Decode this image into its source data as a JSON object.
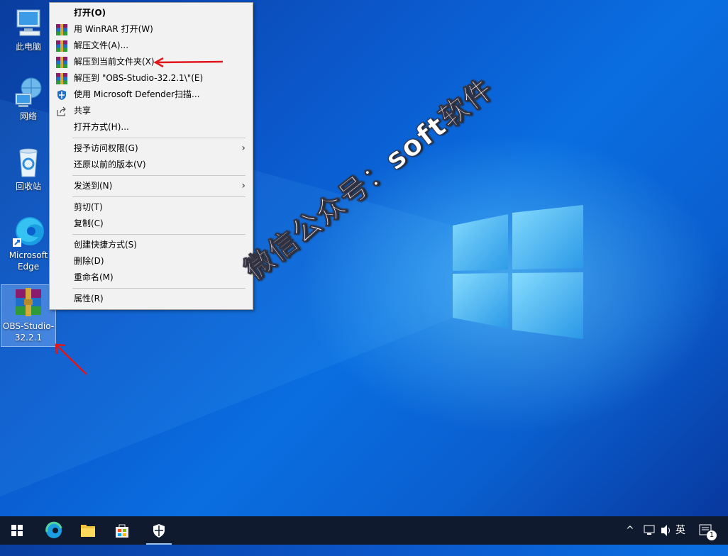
{
  "desktop": {
    "icons": [
      {
        "label": "此电脑",
        "icon": "computer-icon"
      },
      {
        "label": "网络",
        "icon": "network-icon"
      },
      {
        "label": "回收站",
        "icon": "recycle-bin-icon"
      },
      {
        "label": "Microsoft Edge",
        "icon": "edge-icon"
      },
      {
        "label": "OBS-Studio-32.2.1",
        "icon": "winrar-archive-icon"
      }
    ]
  },
  "context_menu": {
    "items": [
      {
        "label": "打开(O)",
        "icon": ""
      },
      {
        "label": "用 WinRAR 打开(W)",
        "icon": "winrar-icon"
      },
      {
        "label": "解压文件(A)...",
        "icon": "winrar-icon"
      },
      {
        "label": "解压到当前文件夹(X)",
        "icon": "winrar-icon"
      },
      {
        "label": "解压到 \"OBS-Studio-32.2.1\\\"(E)",
        "icon": "winrar-icon"
      },
      {
        "label": "使用 Microsoft Defender扫描...",
        "icon": "defender-shield-icon"
      },
      {
        "label": "共享",
        "icon": "share-icon"
      },
      {
        "label": "打开方式(H)...",
        "icon": ""
      },
      {
        "label": "授予访问权限(G)",
        "icon": ""
      },
      {
        "label": "还原以前的版本(V)",
        "icon": ""
      },
      {
        "label": "发送到(N)",
        "icon": ""
      },
      {
        "label": "剪切(T)",
        "icon": ""
      },
      {
        "label": "复制(C)",
        "icon": ""
      },
      {
        "label": "创建快捷方式(S)",
        "icon": ""
      },
      {
        "label": "删除(D)",
        "icon": ""
      },
      {
        "label": "重命名(M)",
        "icon": ""
      },
      {
        "label": "属性(R)",
        "icon": ""
      }
    ]
  },
  "watermark": "微信公众号：soft软件",
  "taskbar": {
    "buttons": [
      "start-icon",
      "edge-icon",
      "file-explorer-icon",
      "store-icon",
      "defender-icon"
    ],
    "ime": "英",
    "notification_count": "1"
  },
  "colors": {
    "annotation_arrow": "#e0161b",
    "taskbar": "#0f1a2e"
  }
}
